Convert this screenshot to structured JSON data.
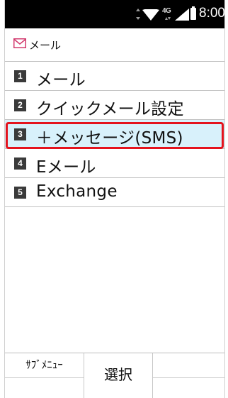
{
  "status_bar": {
    "network_type": "4G",
    "time": "8:00",
    "icons": [
      "data-transfer-arrows-icon",
      "wifi-icon",
      "lte-4g-icon",
      "signal-strength-icon",
      "battery-icon"
    ]
  },
  "header": {
    "icon": "mail-envelope-icon",
    "title": "メール"
  },
  "menu": {
    "selected_index": 2,
    "items": [
      {
        "number": "1",
        "label": "メール"
      },
      {
        "number": "2",
        "label": "クイックメール設定"
      },
      {
        "number": "3",
        "label": "＋メッセージ(SMS)"
      },
      {
        "number": "4",
        "label": "Eメール"
      },
      {
        "number": "5",
        "label": "Exchange"
      }
    ]
  },
  "softkeys": {
    "left": "ｻﾌﾞﾒﾆｭｰ",
    "center": "選択",
    "right": ""
  },
  "colors": {
    "status_bar_bg": "#000000",
    "selected_row_bg": "#d8f1fb",
    "selection_highlight_border": "#e4131d",
    "mail_icon_color": "#d23a6e"
  }
}
